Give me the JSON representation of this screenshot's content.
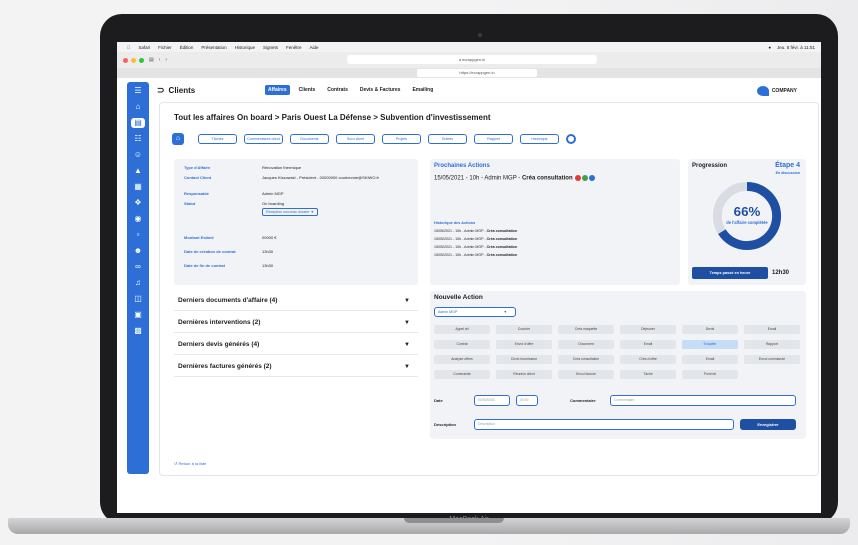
{
  "macbook": {
    "label": "MacBook Air"
  },
  "browser": {
    "menu": [
      "Safari",
      "Fichier",
      "Édition",
      "Présentation",
      "Historique",
      "Signets",
      "Fenêtre",
      "Aide"
    ],
    "clock": "Jeu. 8 févr. à 11:51",
    "url": "a ecrappgen.in",
    "tab_url": "https://ecrappgen.in"
  },
  "topnav": {
    "section_title": "Clients",
    "tabs": [
      "Affaires",
      "Clients",
      "Contrats",
      "Devis & Factures",
      "Emailing"
    ],
    "active_tab": "Affaires",
    "company": "COMPANY"
  },
  "breadcrumb": "Tout les affaires On board > Paris Ouest La Défense > Subvention d'investissement",
  "subtabs": [
    "Tâches",
    "Commentaires client",
    "Documents",
    "Suivi client",
    "Projets",
    "Entités",
    "Rapport",
    "Historique"
  ],
  "info": {
    "rows": [
      {
        "k": "Type d'Affaire",
        "v": "Rénovation thermique"
      },
      {
        "k": "Contact Client",
        "v": "Jacques Kiszowski - Président - 00000000 courbevoie@SKIWO.fr"
      },
      {
        "k": "Responsable",
        "v": "Admin MGP"
      },
      {
        "k": "Statut",
        "v": "On boarding"
      },
      {
        "k": "Montant Estimé",
        "v": "00000 €"
      },
      {
        "k": "Date de création de contrat",
        "v": "13h30"
      },
      {
        "k": "Date de fin de contrat",
        "v": "13h30"
      }
    ],
    "status_select": "Réception nouveau dossier"
  },
  "accordions": [
    "Derniers documents d'affaire (4)",
    "Dernières interventions (2)",
    "Derniers devis générés (4)",
    "Dernières factures générés (2)"
  ],
  "actions": {
    "title": "Prochaines Actions",
    "main_prefix": "15/05/2021 - 10h - Admin MGP - ",
    "main_bold": "Créa consultation",
    "history_title": "Historique des Actions",
    "history": [
      {
        "prefix": "15/05/2021 - 10h - Admin MGP - ",
        "bold": "Créa consultation"
      },
      {
        "prefix": "15/05/2021 - 10h - Admin MGP - ",
        "bold": "Créa consultation"
      },
      {
        "prefix": "15/05/2021 - 10h - Admin MGP - ",
        "bold": "Créa consultation"
      },
      {
        "prefix": "15/05/2021 - 10h - Admin MGP - ",
        "bold": "Créa consultation"
      }
    ],
    "badge_colors": [
      "#e53935",
      "#43a047",
      "#2d6fd6"
    ]
  },
  "progress": {
    "title": "Progression",
    "step": "Étape 4",
    "step_sub": "En discussion",
    "percent": 66,
    "percent_label": "66%",
    "caption": "de l'affaire complétée",
    "time_label": "Temps passé en heure",
    "time_value": "12h30"
  },
  "new_action": {
    "title": "Nouvelle Action",
    "assignee": "Admin MGP",
    "types": [
      "Appel tel",
      "Courrier",
      "Créa maquette",
      "Déjeuner",
      "Devis",
      "Email",
      "Contrat",
      "Envoi d'offre",
      "Document",
      "Email",
      "Enquête",
      "Rapport",
      "Analyse offres",
      "Choix fournisseur",
      "Créa consultation",
      "Créa d'offre",
      "Email",
      "Envoi commande",
      "Commande",
      "Réunion client",
      "Envoi facture",
      "Tâche",
      "Point tel"
    ],
    "highlighted_index": 10,
    "date_label": "Date",
    "date_placeholder": "00/00/0000",
    "time_placeholder": "00:00",
    "comment_label": "Commentaire",
    "comment_placeholder": "Commentaire",
    "description_label": "Description",
    "description_placeholder": "Description",
    "save_label": "Enregistrer"
  },
  "back_link": "Retour à la liste",
  "colors": {
    "accent": "#2d6fd6",
    "dark_button": "#1f4fa3",
    "panel_bg": "#f1f3f6"
  }
}
